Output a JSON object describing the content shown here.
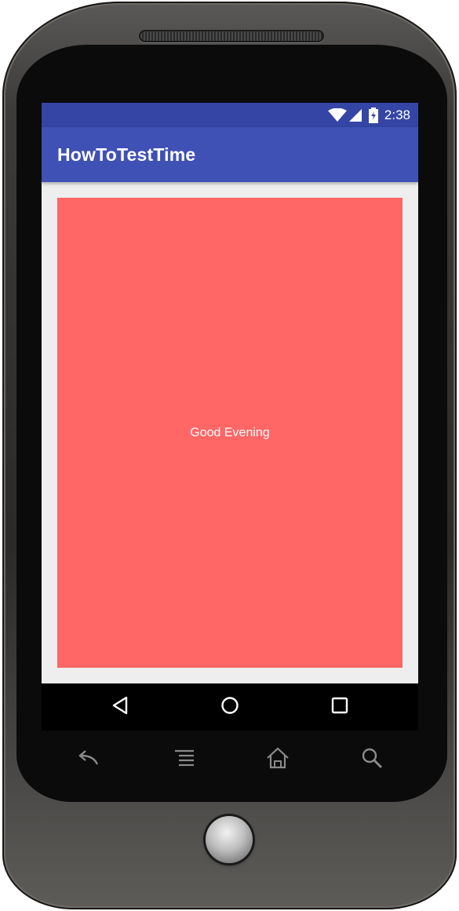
{
  "status_bar": {
    "time": "2:38",
    "icons": [
      "wifi-icon",
      "cell-signal-icon",
      "battery-charging-icon"
    ]
  },
  "app_bar": {
    "title": "HowToTestTime"
  },
  "content": {
    "greeting": "Good Evening",
    "box_color": "#ff6666"
  },
  "nav_bar": {
    "buttons": [
      "back-icon",
      "home-icon",
      "recents-icon"
    ]
  },
  "hardware_keys": [
    "back-icon",
    "menu-icon",
    "home-icon",
    "search-icon"
  ],
  "colors": {
    "primary": "#3f51b5",
    "primary_dark": "#3545a5",
    "background": "#eeeeee"
  }
}
